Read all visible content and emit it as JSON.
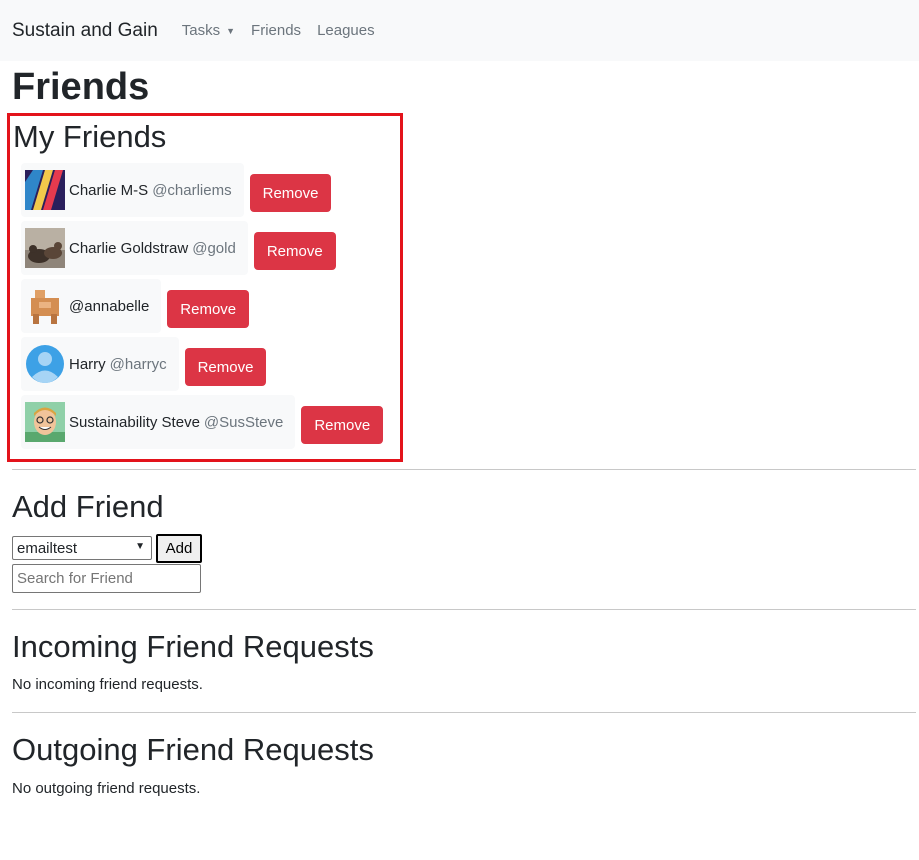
{
  "nav": {
    "brand": "Sustain and Gain",
    "items": [
      {
        "label": "Tasks",
        "dropdown": true
      },
      {
        "label": "Friends"
      },
      {
        "label": "Leagues"
      }
    ]
  },
  "page_title": "Friends",
  "my_friends": {
    "title": "My Friends",
    "remove_label": "Remove",
    "items": [
      {
        "name": "Charlie M-S",
        "handle": "@charliems",
        "avatar": "stripes-icon"
      },
      {
        "name": "Charlie Goldstraw",
        "handle": "@gold",
        "avatar": "seals-photo"
      },
      {
        "name": "",
        "handle": "@annabelle",
        "avatar": "blocky-animal-icon"
      },
      {
        "name": "Harry",
        "handle": "@harryc",
        "avatar": "default-user-icon"
      },
      {
        "name": "Sustainability Steve",
        "handle": "@SusSteve",
        "avatar": "cartoon-face-icon"
      }
    ]
  },
  "add_friend": {
    "title": "Add Friend",
    "selected_option": "emailtest",
    "add_label": "Add",
    "search_placeholder": "Search for Friend"
  },
  "incoming": {
    "title": "Incoming Friend Requests",
    "empty_text": "No incoming friend requests."
  },
  "outgoing": {
    "title": "Outgoing Friend Requests",
    "empty_text": "No outgoing friend requests."
  },
  "colors": {
    "danger": "#dc3545",
    "highlight": "#e3131b",
    "muted": "#6c757d",
    "navbar_bg": "#f8f9fa"
  }
}
